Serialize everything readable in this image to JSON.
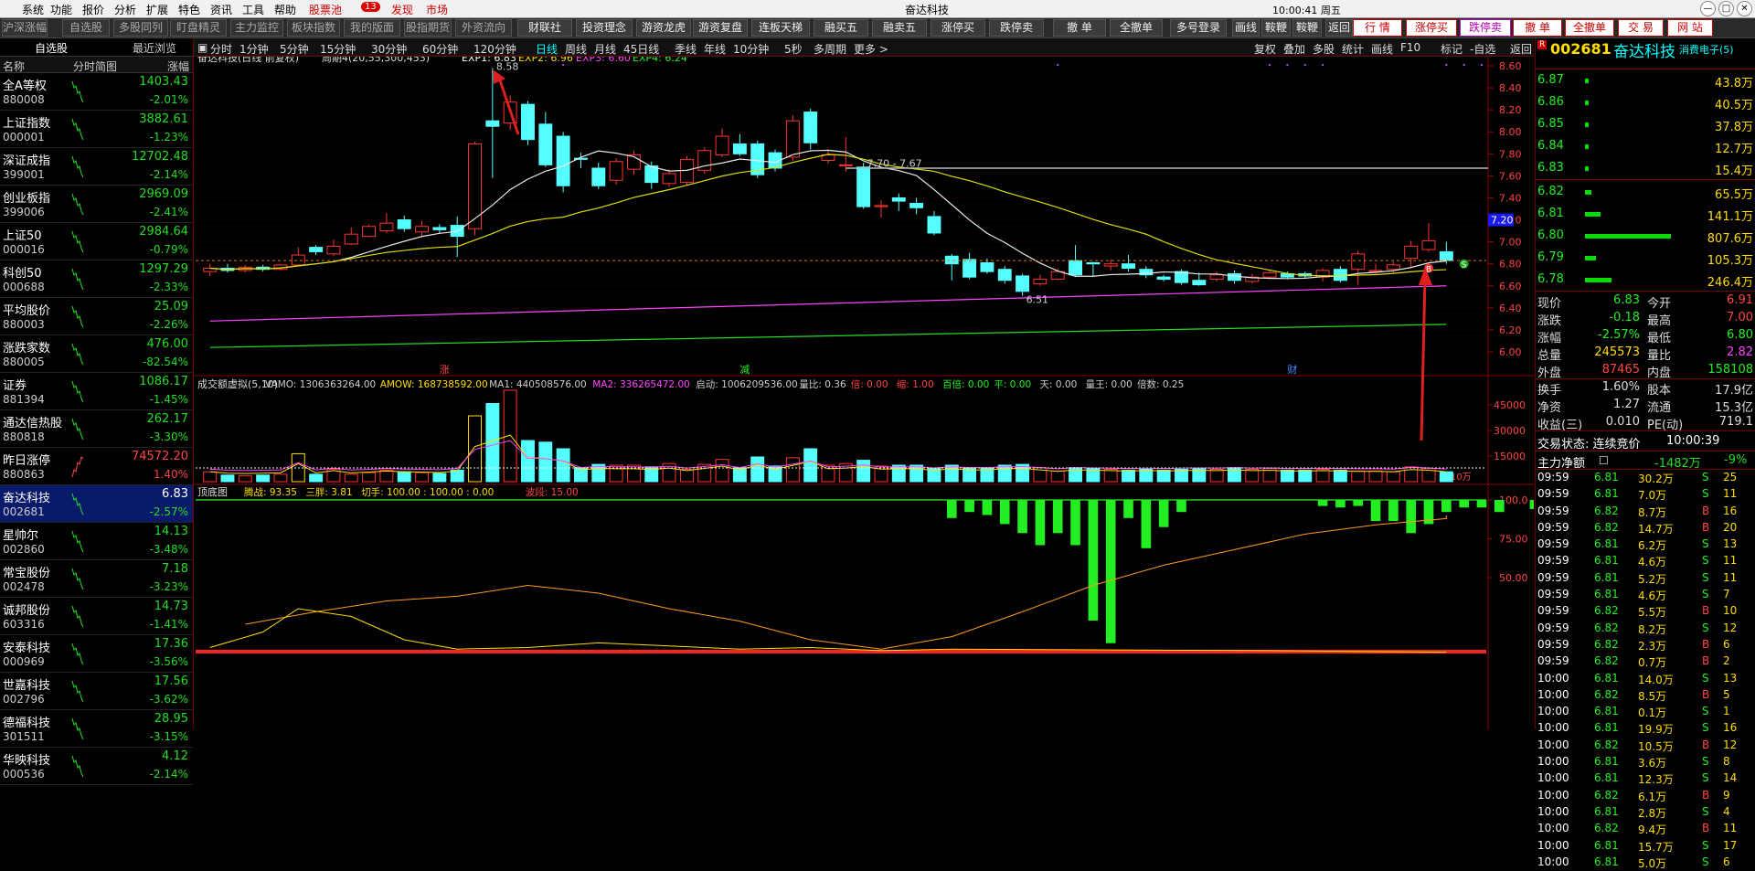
{
  "menubar": {
    "items": [
      "系统",
      "功能",
      "报价",
      "分析",
      "扩展",
      "特色",
      "资讯",
      "工具",
      "帮助"
    ],
    "stock_pool": "股票池",
    "pool_count": "13",
    "discover": "发现",
    "market": "市场",
    "center_title": "奋达科技",
    "clock": "10:00:41 周五"
  },
  "toolbar": {
    "left_buttons": [
      "沪深涨幅",
      "自选股",
      "多股同列",
      "盯盘精灵",
      "主力监控",
      "板块指数",
      "我的版面",
      "股指期货",
      "外资流向"
    ],
    "mid_buttons": [
      "财联社",
      "投资理念",
      "游资龙虎",
      "游资复盘",
      "连板天梯",
      "融买五",
      "融卖五",
      "涨停买",
      "跌停卖",
      "撤 单",
      "全撤单",
      "多号登录",
      "画线",
      "鞍鞭A",
      "鞍鞭B",
      "返回"
    ],
    "right_buttons": [
      "行 情",
      "涨停买",
      "跌停卖",
      "撤 单",
      "全撤单",
      "交 易",
      "网 站"
    ]
  },
  "left": {
    "tab_watch": "自选股",
    "tab_recent": "最近浏览",
    "hdr_name": "名称",
    "hdr_chart": "分时简图",
    "hdr_pct": "涨幅",
    "rows": [
      {
        "name": "全A等权",
        "code": "880008",
        "price": "1403.43",
        "pct": "-2.01%",
        "dir": "dn"
      },
      {
        "name": "上证指数",
        "code": "000001",
        "price": "3882.61",
        "pct": "-1.23%",
        "dir": "dn"
      },
      {
        "name": "深证成指",
        "code": "399001",
        "price": "12702.48",
        "pct": "-2.14%",
        "dir": "dn"
      },
      {
        "name": "创业板指",
        "code": "399006",
        "price": "2969.09",
        "pct": "-2.41%",
        "dir": "dn"
      },
      {
        "name": "上证50",
        "code": "000016",
        "price": "2984.64",
        "pct": "-0.79%",
        "dir": "dn"
      },
      {
        "name": "科创50",
        "code": "000688",
        "price": "1297.29",
        "pct": "-2.33%",
        "dir": "dn"
      },
      {
        "name": "平均股价",
        "code": "880003",
        "price": "25.09",
        "pct": "-2.26%",
        "dir": "dn"
      },
      {
        "name": "涨跌家数",
        "code": "880005",
        "price": "476.00",
        "pct": "-82.54%",
        "dir": "dn"
      },
      {
        "name": "证券",
        "code": "881394",
        "price": "1086.17",
        "pct": "-1.45%",
        "dir": "dn"
      },
      {
        "name": "通达信热股",
        "code": "880818",
        "price": "262.17",
        "pct": "-3.30%",
        "dir": "dn"
      },
      {
        "name": "昨日涨停",
        "code": "880863",
        "price": "74572.20",
        "pct": "1.40%",
        "dir": "up"
      },
      {
        "name": "奋达科技",
        "code": "002681",
        "price": "6.83",
        "pct": "-2.57%",
        "dir": "dn",
        "selected": true
      },
      {
        "name": "星帅尔",
        "code": "002860",
        "price": "14.13",
        "pct": "-3.48%",
        "dir": "dn"
      },
      {
        "name": "常宝股份",
        "code": "002478",
        "price": "7.18",
        "pct": "-3.23%",
        "dir": "dn"
      },
      {
        "name": "诚邦股份",
        "code": "603316",
        "price": "14.73",
        "pct": "-1.41%",
        "dir": "dn"
      },
      {
        "name": "安泰科技",
        "code": "000969",
        "price": "17.36",
        "pct": "-3.56%",
        "dir": "dn"
      },
      {
        "name": "世嘉科技",
        "code": "002796",
        "price": "17.56",
        "pct": "-3.62%",
        "dir": "dn"
      },
      {
        "name": "德福科技",
        "code": "301511",
        "price": "28.95",
        "pct": "-3.15%",
        "dir": "dn"
      },
      {
        "name": "华映科技",
        "code": "000536",
        "price": "4.12",
        "pct": "-2.14%",
        "dir": "dn"
      }
    ]
  },
  "charttb": {
    "left": [
      "分时",
      "1分钟",
      "5分钟",
      "15分钟",
      "30分钟",
      "60分钟",
      "120分钟",
      "日线",
      "周线",
      "月线",
      "45日线",
      "季线",
      "年线",
      "10分钟",
      "5秒",
      "多周期",
      "更多 >"
    ],
    "right": [
      "复权",
      "叠加",
      "多股",
      "统计",
      "画线",
      "F10",
      "标记",
      "-自选",
      "返回"
    ]
  },
  "chart": {
    "main_title": "奋达科技(日线 前复权)",
    "period_label": "周期4(20,55,300,453)",
    "exp1": "EXP1: 6.83",
    "exp2": "EXP2: 6.96",
    "exp3": "EXP3: 6.60",
    "exp4": "EXP4: 6.24",
    "price_ticks": [
      "8.60",
      "8.40",
      "8.20",
      "8.00",
      "7.80",
      "7.60",
      "7.40",
      "7.20",
      "7.00",
      "6.80",
      "6.60",
      "6.40",
      "6.20",
      "6.00"
    ],
    "high_label": "8.58",
    "low_label": "6.51",
    "range_label": "7.70 - 7.67",
    "price_tag": "7.20",
    "markers": [
      "涨",
      "减",
      "财"
    ],
    "vol_title": "成交额虚拟(5,10)",
    "vol_vals": [
      "VAMO: 1306363264.00",
      "AMOW: 168738592.00",
      "MA1: 440508576.00",
      "MA2: 336265472.00",
      "启动: 1006209536.00",
      "量比: 0.36",
      "倍: 0.00",
      "缩: 1.00",
      "百倍: 0.00",
      "平: 0.00",
      "天: 0.00",
      "量王: 0.00",
      "倍数: 0.25"
    ],
    "vol_ticks": [
      "45000",
      "30000",
      "15000"
    ],
    "vol_unit": "X10万",
    "ind_title": "顶底图",
    "ind_vals": [
      "腾战: 93.35",
      "三胖: 3.81",
      "切手: 100.00 : 100.00 : 0.00",
      "波段: 15.00"
    ],
    "ind_ticks": [
      "100.0",
      "75.00",
      "50.00"
    ]
  },
  "right": {
    "code": "002681",
    "name": "奋达科技",
    "r_label": "R",
    "sub": "消费电子(5)",
    "asks": [
      {
        "p": "6.87",
        "v": "43.8万",
        "w": 0.03
      },
      {
        "p": "6.86",
        "v": "40.5万",
        "w": 0.03
      },
      {
        "p": "6.85",
        "v": "37.8万",
        "w": 0.03
      },
      {
        "p": "6.84",
        "v": "12.7万",
        "w": 0.01
      },
      {
        "p": "6.83",
        "v": "15.4万",
        "w": 0.01
      }
    ],
    "bids": [
      {
        "p": "6.82",
        "v": "65.5万",
        "w": 0.06
      },
      {
        "p": "6.81",
        "v": "141.1万",
        "w": 0.14
      },
      {
        "p": "6.80",
        "v": "807.6万",
        "w": 0.78
      },
      {
        "p": "6.79",
        "v": "105.3万",
        "w": 0.1
      },
      {
        "p": "6.78",
        "v": "246.4万",
        "w": 0.24
      }
    ],
    "quote": [
      [
        "现价",
        "6.83",
        "今开",
        "6.91"
      ],
      [
        "涨跌",
        "-0.18",
        "最高",
        "7.00"
      ],
      [
        "涨幅",
        "-2.57%",
        "最低",
        "6.80"
      ],
      [
        "总量",
        "245573",
        "量比",
        "2.82"
      ],
      [
        "外盘",
        "87465",
        "内盘",
        "158108"
      ],
      [
        "换手",
        "1.60%",
        "股本",
        "17.9亿"
      ],
      [
        "净资",
        "1.27",
        "流通",
        "15.3亿"
      ],
      [
        "收益(三)",
        "0.010",
        "PE(动)",
        "719.1"
      ]
    ],
    "trade_status": "交易状态: 连续竞价",
    "trade_time": "10:00:39",
    "main_net_label": "主力净额",
    "main_net": "-1482万",
    "main_pct": "-9%",
    "ticks": [
      [
        "09:59",
        "6.81",
        "30.2万",
        "S",
        "25"
      ],
      [
        "09:59",
        "6.81",
        "7.0万",
        "S",
        "11"
      ],
      [
        "09:59",
        "6.82",
        "8.7万",
        "B",
        "16"
      ],
      [
        "09:59",
        "6.82",
        "14.7万",
        "B",
        "20"
      ],
      [
        "09:59",
        "6.81",
        "6.2万",
        "S",
        "13"
      ],
      [
        "09:59",
        "6.81",
        "4.6万",
        "S",
        "11"
      ],
      [
        "09:59",
        "6.81",
        "5.2万",
        "S",
        "11"
      ],
      [
        "09:59",
        "6.81",
        "4.6万",
        "S",
        "7"
      ],
      [
        "09:59",
        "6.82",
        "5.5万",
        "B",
        "10"
      ],
      [
        "09:59",
        "6.82",
        "8.2万",
        "S",
        "12"
      ],
      [
        "09:59",
        "6.82",
        "2.3万",
        "B",
        "6"
      ],
      [
        "09:59",
        "6.82",
        "0.7万",
        "B",
        "2"
      ],
      [
        "10:00",
        "6.81",
        "14.0万",
        "S",
        "13"
      ],
      [
        "10:00",
        "6.82",
        "8.5万",
        "B",
        "5"
      ],
      [
        "10:00",
        "6.81",
        "0.1万",
        "S",
        "1"
      ],
      [
        "10:00",
        "6.81",
        "19.9万",
        "S",
        "16"
      ],
      [
        "10:00",
        "6.82",
        "10.5万",
        "B",
        "12"
      ],
      [
        "10:00",
        "6.81",
        "3.6万",
        "S",
        "8"
      ],
      [
        "10:00",
        "6.81",
        "12.3万",
        "S",
        "14"
      ],
      [
        "10:00",
        "6.82",
        "6.1万",
        "B",
        "9"
      ],
      [
        "10:00",
        "6.81",
        "2.8万",
        "S",
        "4"
      ],
      [
        "10:00",
        "6.82",
        "9.4万",
        "B",
        "11"
      ],
      [
        "10:00",
        "6.81",
        "15.7万",
        "S",
        "17"
      ],
      [
        "10:00",
        "6.81",
        "5.0万",
        "S",
        "6"
      ]
    ]
  }
}
